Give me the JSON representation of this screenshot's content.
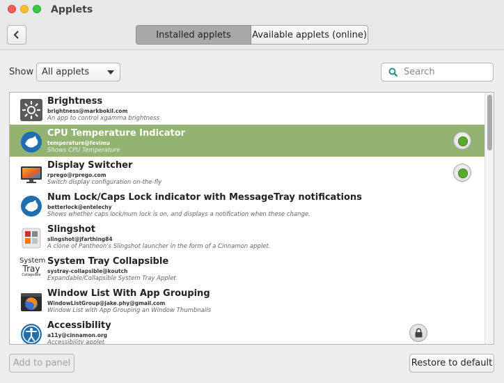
{
  "window": {
    "title": "Applets"
  },
  "tabs": [
    {
      "label": "Installed applets",
      "active": true
    },
    {
      "label": "Available applets (online)",
      "active": false
    }
  ],
  "filter": {
    "show_label": "Show",
    "selected": "All applets"
  },
  "search": {
    "placeholder": "Search",
    "value": ""
  },
  "applets": [
    {
      "name": "Brightness",
      "uuid": "brightness@markbokil.com",
      "description": "An app to control xgamma brightness",
      "icon": "brightness-icon",
      "enabled": false,
      "selected": false
    },
    {
      "name": "CPU Temperature Indicator",
      "uuid": "temperature@fevimu",
      "description": "Shows CPU Temperature",
      "icon": "cinnamon-icon",
      "enabled": true,
      "selected": true
    },
    {
      "name": "Display Switcher",
      "uuid": "rprego@rprego.com",
      "description": "Switch display configuration on-the-fly",
      "icon": "display-icon",
      "enabled": true,
      "selected": false
    },
    {
      "name": "Num Lock/Caps Lock indicator with MessageTray notifications",
      "uuid": "betterlock@entelechy",
      "description": "Shows whether caps lock/num lock is on, and displays a notification when these change.",
      "icon": "cinnamon-icon",
      "enabled": false,
      "selected": false
    },
    {
      "name": "Slingshot",
      "uuid": "slingshot@jfarthing84",
      "description": "A clone of Pantheon's Slingshot launcher in the form of a Cinnamon applet.",
      "icon": "slingshot-icon",
      "enabled": false,
      "selected": false
    },
    {
      "name": "System Tray Collapsible",
      "uuid": "systray-collapsible@koutch",
      "description": "Expandable/Collapsible System Tray Applet",
      "icon": "systemtray-icon",
      "icon_text": [
        "System",
        "Tray",
        "Collapsible"
      ],
      "enabled": false,
      "selected": false
    },
    {
      "name": "Window List With App Grouping",
      "uuid": "WindowListGroup@jake.phy@gmail.com",
      "description": "Window List with App Grouping an Window Thumbnails",
      "icon": "firefox-window-icon",
      "enabled": false,
      "selected": false
    },
    {
      "name": "Accessibility",
      "uuid": "a11y@cinnamon.org",
      "description": "Accessibility applet",
      "icon": "accessibility-icon",
      "enabled": false,
      "locked": true,
      "selected": false
    }
  ],
  "buttons": {
    "add": "Add to panel",
    "restore": "Restore to default"
  },
  "colors": {
    "selected_row": "#92b372",
    "enabled_dot": "#5ba92f"
  }
}
